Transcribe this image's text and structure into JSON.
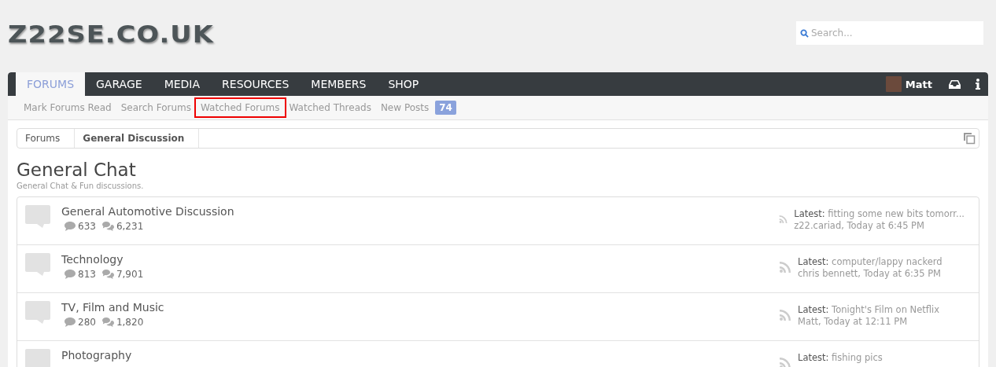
{
  "logo": {
    "text": "Z22SE.CO.UK"
  },
  "search": {
    "placeholder": "Search..."
  },
  "nav_tabs": [
    {
      "label": "FORUMS",
      "selected": true
    },
    {
      "label": "GARAGE",
      "selected": false
    },
    {
      "label": "MEDIA",
      "selected": false
    },
    {
      "label": "RESOURCES",
      "selected": false
    },
    {
      "label": "MEMBERS",
      "selected": false
    },
    {
      "label": "SHOP",
      "selected": false
    }
  ],
  "user": {
    "name": "Matt"
  },
  "sub_nav": [
    {
      "label": "Mark Forums Read",
      "highlighted": false
    },
    {
      "label": "Search Forums",
      "highlighted": false
    },
    {
      "label": "Watched Forums",
      "highlighted": true
    },
    {
      "label": "Watched Threads",
      "highlighted": false
    },
    {
      "label": "New Posts",
      "highlighted": false,
      "badge": "74"
    }
  ],
  "breadcrumb": [
    {
      "label": "Forums",
      "current": false
    },
    {
      "label": "General Discussion",
      "current": true
    }
  ],
  "page": {
    "title": "General Chat",
    "description": "General Chat & Fun discussions."
  },
  "forums": [
    {
      "title": "General Automotive Discussion",
      "threads": "633",
      "messages": "6,231",
      "latest_label": "Latest:",
      "latest_title": "fitting some new bits tomorr...",
      "latest_meta": "z22.cariad, Today at 6:45 PM"
    },
    {
      "title": "Technology",
      "threads": "813",
      "messages": "7,901",
      "latest_label": "Latest:",
      "latest_title": "computer/lappy nackerd",
      "latest_meta": "chris bennett, Today at 6:35 PM"
    },
    {
      "title": "TV, Film and Music",
      "threads": "280",
      "messages": "1,820",
      "latest_label": "Latest:",
      "latest_title": "Tonight's Film on Netflix",
      "latest_meta": "Matt, Today at 12:11 PM"
    },
    {
      "title": "Photography",
      "latest_label": "Latest:",
      "latest_title": "fishing pics"
    }
  ]
}
